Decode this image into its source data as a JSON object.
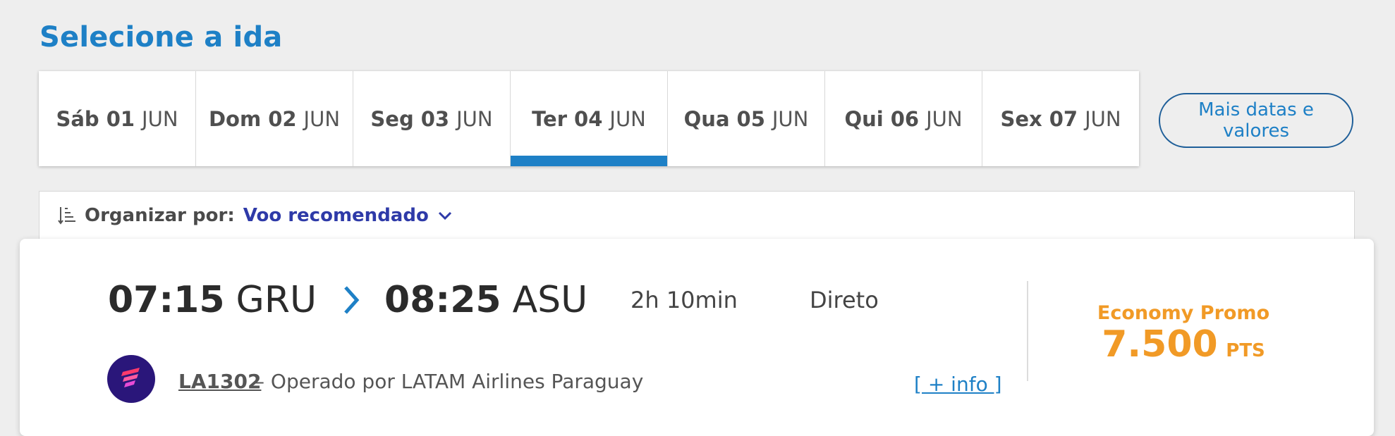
{
  "page": {
    "title": "Selecione a ida"
  },
  "date_tabs": [
    {
      "day": "Sáb",
      "num": "01",
      "month": "JUN",
      "active": false
    },
    {
      "day": "Dom",
      "num": "02",
      "month": "JUN",
      "active": false
    },
    {
      "day": "Seg",
      "num": "03",
      "month": "JUN",
      "active": false
    },
    {
      "day": "Ter",
      "num": "04",
      "month": "JUN",
      "active": true
    },
    {
      "day": "Qua",
      "num": "05",
      "month": "JUN",
      "active": false
    },
    {
      "day": "Qui",
      "num": "06",
      "month": "JUN",
      "active": false
    },
    {
      "day": "Sex",
      "num": "07",
      "month": "JUN",
      "active": false
    }
  ],
  "more_dates": {
    "label_line1": "Mais datas e",
    "label_line2": "valores"
  },
  "sort": {
    "label": "Organizar por:",
    "value": "Voo recomendado",
    "icon": "sort-icon",
    "chevron": "chevron-down-icon"
  },
  "flight": {
    "depart_time": "07:15",
    "depart_code": "GRU",
    "arrive_time": "08:25",
    "arrive_code": "ASU",
    "duration": "2h 10min",
    "stops": "Direto",
    "flight_number": "LA1302",
    "operated_by": "– Operado por LATAM Airlines Paraguay",
    "more_info": "[ + info ]",
    "fare": {
      "name": "Economy Promo",
      "amount": "7.500",
      "unit": "PTS"
    }
  },
  "colors": {
    "accent_blue": "#1e80c6",
    "sort_blue": "#2e3aa8",
    "fare_orange": "#f19a26",
    "airline_purple": "#2a167a",
    "background": "#eeeeee"
  }
}
